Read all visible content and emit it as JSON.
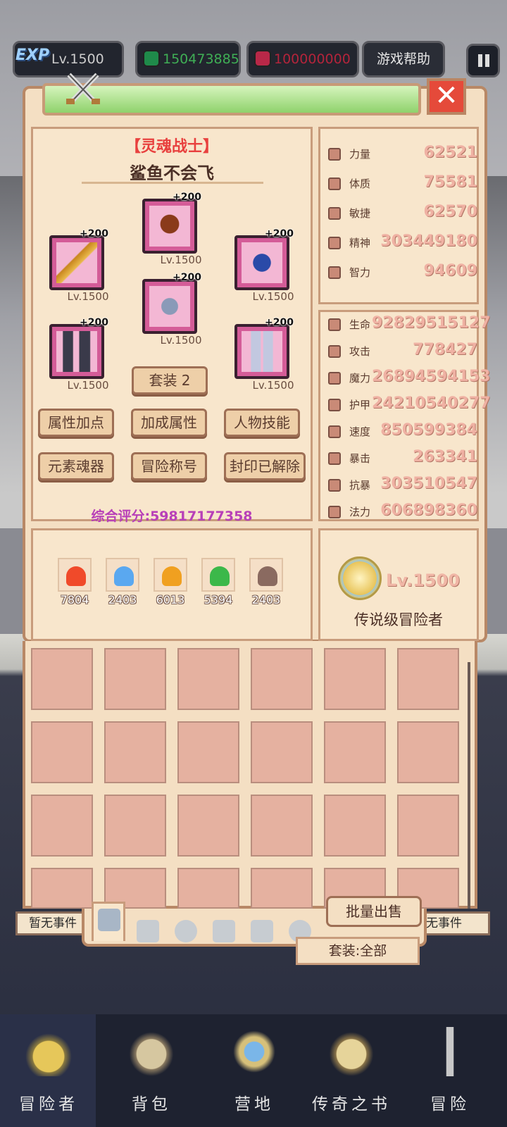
{
  "topbar": {
    "exp_badge": "EXP",
    "level": "Lv.1500",
    "emeralds": "150473885",
    "rubies": "100000000",
    "help_label": "游戏帮助"
  },
  "character": {
    "class_name": "【灵魂战士】",
    "name": "鲨鱼不会飞",
    "equipment": [
      {
        "slot": "helmet",
        "plus": "+200",
        "level": "Lv.1500"
      },
      {
        "slot": "weapon",
        "plus": "+200",
        "level": "Lv.1500"
      },
      {
        "slot": "necklace",
        "plus": "+200",
        "level": "Lv.1500"
      },
      {
        "slot": "armor",
        "plus": "+200",
        "level": "Lv.1500"
      },
      {
        "slot": "gloves",
        "plus": "+200",
        "level": "Lv.1500"
      },
      {
        "slot": "pants",
        "plus": "+200",
        "level": "Lv.1500"
      }
    ],
    "set_label": "套装 2",
    "buttons": [
      "属性加点",
      "加成属性",
      "人物技能",
      "元素魂器",
      "冒险称号",
      "封印已解除"
    ],
    "score": "综合评分:59817177358"
  },
  "base_stats": [
    {
      "name": "力量",
      "value": "62521",
      "icon": "strength-icon"
    },
    {
      "name": "体质",
      "value": "75581",
      "icon": "heart-icon"
    },
    {
      "name": "敏捷",
      "value": "62570",
      "icon": "boot-icon"
    },
    {
      "name": "精神",
      "value": "303449180",
      "icon": "star-icon"
    },
    {
      "name": "智力",
      "value": "94609",
      "icon": "brain-icon"
    }
  ],
  "combat_stats": [
    {
      "name": "生命",
      "value": "92829515127",
      "icon": "heart-icon"
    },
    {
      "name": "攻击",
      "value": "778427",
      "icon": "sword-icon"
    },
    {
      "name": "魔力",
      "value": "26894594153",
      "icon": "magic-icon"
    },
    {
      "name": "护甲",
      "value": "24210540277",
      "icon": "shield-icon"
    },
    {
      "name": "速度",
      "value": "850599384",
      "icon": "boot-icon"
    },
    {
      "name": "暴击",
      "value": "263341",
      "icon": "crit-icon"
    },
    {
      "name": "抗暴",
      "value": "303510547",
      "icon": "crit-resist-icon"
    },
    {
      "name": "法力",
      "value": "606898360",
      "icon": "star-icon"
    }
  ],
  "elements": [
    {
      "name": "fire",
      "value": "7804",
      "color": "#f04a2a"
    },
    {
      "name": "water",
      "value": "2403",
      "color": "#5aa8f0"
    },
    {
      "name": "lightning",
      "value": "6013",
      "color": "#f0a020"
    },
    {
      "name": "earth",
      "value": "5394",
      "color": "#3cb84a"
    },
    {
      "name": "dark",
      "value": "2403",
      "color": "#8a6a60"
    }
  ],
  "rank": {
    "level": "Lv.1500",
    "title": "传说级冒险者"
  },
  "inventory": {
    "sell_label": "批量出售",
    "set_filter": "套装:全部",
    "tabs": [
      "weapon-tab-icon",
      "armor-tab-icon",
      "helmet-tab-icon",
      "body-tab-icon",
      "pants-tab-icon",
      "ring-tab-icon"
    ]
  },
  "events": {
    "left": "暂无事件",
    "right": "无事件"
  },
  "nav": [
    {
      "label": "冒险者",
      "icon": "helmet-icon"
    },
    {
      "label": "背包",
      "icon": "backpack-icon"
    },
    {
      "label": "营地",
      "icon": "banner-icon"
    },
    {
      "label": "传奇之书",
      "icon": "book-icon"
    },
    {
      "label": "冒险",
      "icon": "sword-icon"
    }
  ]
}
